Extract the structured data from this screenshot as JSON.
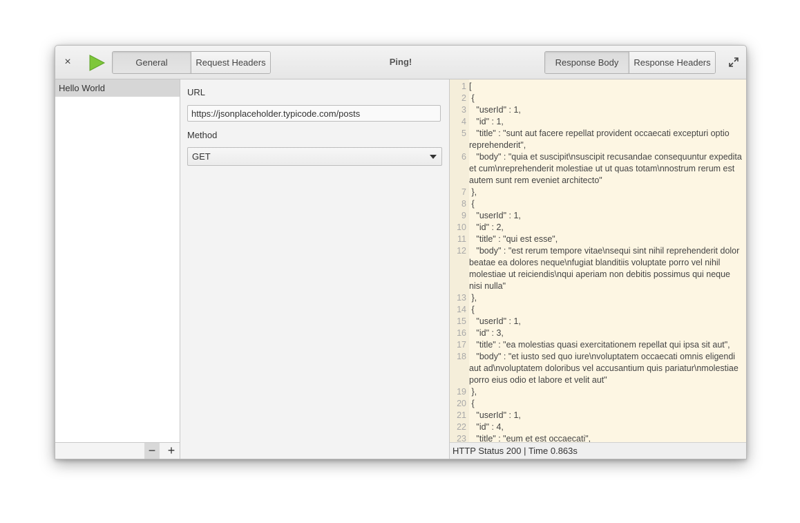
{
  "header": {
    "close_label": "×",
    "title": "Ping!",
    "left_tabs": [
      "General",
      "Request Headers"
    ],
    "right_tabs": [
      "Response Body",
      "Response Headers"
    ]
  },
  "sidebar": {
    "items": [
      {
        "label": "Hello World"
      }
    ],
    "remove_label": "−",
    "add_label": "+"
  },
  "request": {
    "url_label": "URL",
    "url_value": "https://jsonplaceholder.typicode.com/posts",
    "method_label": "Method",
    "method_value": "GET"
  },
  "response": {
    "lines": [
      {
        "n": "1",
        "t": "["
      },
      {
        "n": "2",
        "t": " {"
      },
      {
        "n": "3",
        "t": "   \"userId\" : 1,"
      },
      {
        "n": "4",
        "t": "   \"id\" : 1,"
      },
      {
        "n": "5",
        "t": "   \"title\" : \"sunt aut facere repellat provident occaecati excepturi optio reprehenderit\","
      },
      {
        "n": "6",
        "t": "   \"body\" : \"quia et suscipit\\nsuscipit recusandae consequuntur expedita et cum\\nreprehenderit molestiae ut ut quas totam\\nnostrum rerum est autem sunt rem eveniet architecto\""
      },
      {
        "n": "7",
        "t": " },"
      },
      {
        "n": "8",
        "t": " {"
      },
      {
        "n": "9",
        "t": "   \"userId\" : 1,"
      },
      {
        "n": "10",
        "t": "   \"id\" : 2,"
      },
      {
        "n": "11",
        "t": "   \"title\" : \"qui est esse\","
      },
      {
        "n": "12",
        "t": "   \"body\" : \"est rerum tempore vitae\\nsequi sint nihil reprehenderit dolor beatae ea dolores neque\\nfugiat blanditiis voluptate porro vel nihil molestiae ut reiciendis\\nqui aperiam non debitis possimus qui neque nisi nulla\""
      },
      {
        "n": "13",
        "t": " },"
      },
      {
        "n": "14",
        "t": " {"
      },
      {
        "n": "15",
        "t": "   \"userId\" : 1,"
      },
      {
        "n": "16",
        "t": "   \"id\" : 3,"
      },
      {
        "n": "17",
        "t": "   \"title\" : \"ea molestias quasi exercitationem repellat qui ipsa sit aut\","
      },
      {
        "n": "18",
        "t": "   \"body\" : \"et iusto sed quo iure\\nvoluptatem occaecati omnis eligendi aut ad\\nvoluptatem doloribus vel accusantium quis pariatur\\nmolestiae porro eius odio et labore et velit aut\""
      },
      {
        "n": "19",
        "t": " },"
      },
      {
        "n": "20",
        "t": " {"
      },
      {
        "n": "21",
        "t": "   \"userId\" : 1,"
      },
      {
        "n": "22",
        "t": "   \"id\" : 4,"
      },
      {
        "n": "23",
        "t": "   \"title\" : \"eum et est occaecati\","
      }
    ]
  },
  "status": {
    "text": "HTTP Status 200 | Time 0.863s"
  },
  "colors": {
    "run_icon": "#7ec73a",
    "response_bg": "#fdf6e3"
  }
}
